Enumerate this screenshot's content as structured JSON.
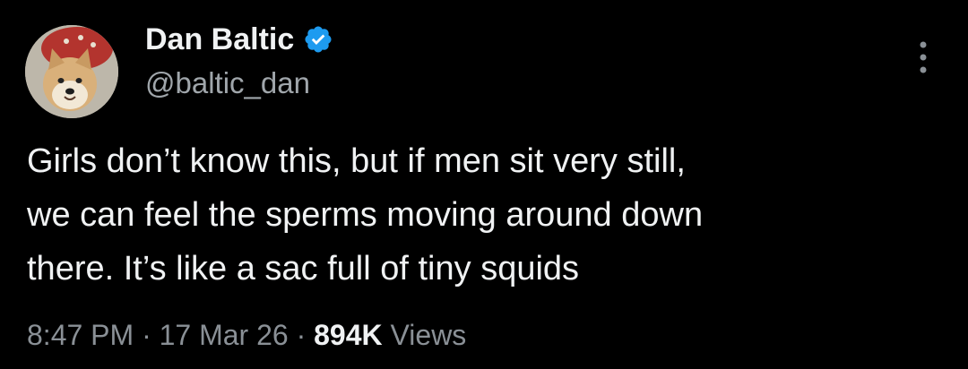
{
  "author": {
    "display_name": "Dan Baltic",
    "handle": "@baltic_dan",
    "verified_badge_icon": "verified-badge-icon",
    "avatar_icon": "shiba-dog-avatar",
    "badge_color": "#1d9bf0"
  },
  "menu": {
    "icon": "more-options-icon"
  },
  "tweet": {
    "lines": [
      "Girls don’t know this, but if men sit very still,",
      "we can feel the sperms moving around down",
      "there. It’s like a sac full of tiny squids"
    ]
  },
  "meta": {
    "time": "8:47 PM",
    "separator": "·",
    "date": "17 Mar 26",
    "views_count": "894K",
    "views_label": "Views"
  }
}
